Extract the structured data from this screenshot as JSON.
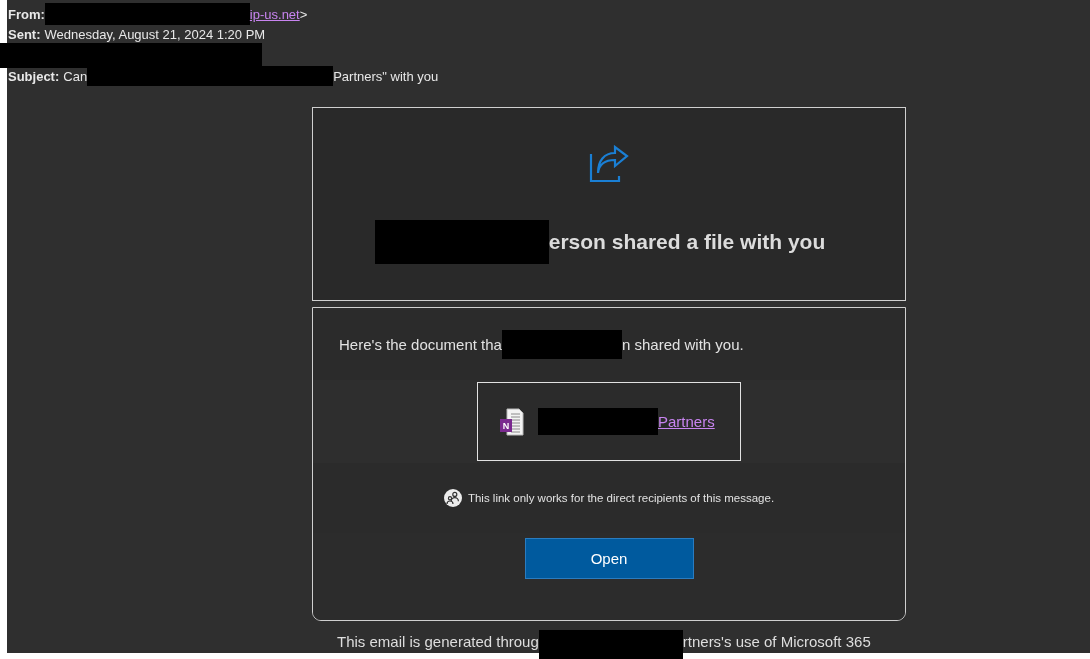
{
  "header": {
    "lines": [
      [
        {
          "kind": "label",
          "text": "From:"
        },
        {
          "kind": "redaction"
        },
        {
          "kind": "link",
          "text": "ip-us.net"
        },
        {
          "kind": "text",
          "text": ">"
        }
      ],
      [
        {
          "kind": "label",
          "text": "Sent:"
        },
        {
          "kind": "text",
          "text": "Wednesday, August 21, 2024 1:20 PM"
        }
      ],
      [
        {
          "kind": "redaction"
        }
      ],
      [
        {
          "kind": "label",
          "text": "Subject:"
        },
        {
          "kind": "text",
          "text": "Can"
        },
        {
          "kind": "redaction"
        },
        {
          "kind": "text",
          "text": "Partners\" with you"
        }
      ]
    ]
  },
  "share_card": {
    "title": [
      {
        "kind": "redaction"
      },
      {
        "kind": "text",
        "text": "erson shared a file with you"
      }
    ]
  },
  "document_card": {
    "message": [
      {
        "kind": "text",
        "text": "Here's the document tha"
      },
      {
        "kind": "redaction"
      },
      {
        "kind": "text",
        "text": "n shared with you."
      }
    ],
    "file": {
      "icon_letter": "N",
      "name": [
        {
          "kind": "redaction"
        },
        {
          "kind": "link",
          "text": "Partners"
        }
      ]
    },
    "notice": "This link only works for the direct recipients of this message.",
    "button": "Open"
  },
  "footer": [
    {
      "kind": "text",
      "text": "This email is generated throug"
    },
    {
      "kind": "redaction"
    },
    {
      "kind": "text",
      "text": "rtners's use of Microsoft 365"
    }
  ]
}
